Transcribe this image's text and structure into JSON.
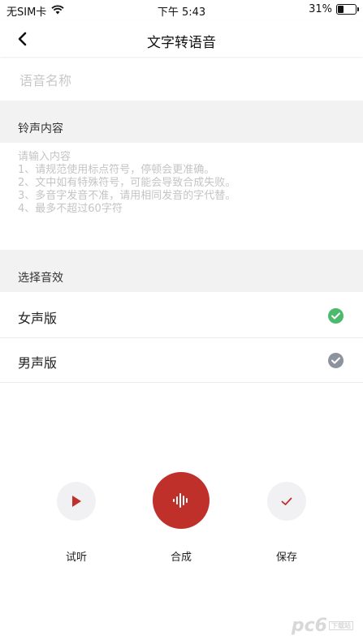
{
  "status_bar": {
    "carrier": "无SIM卡",
    "time": "下午 5:43",
    "battery_percent": "31%",
    "battery_level": 0.31
  },
  "nav": {
    "title": "文字转语音"
  },
  "voice_name": {
    "placeholder": "语音名称",
    "value": ""
  },
  "ringtone_section": {
    "title": "铃声内容",
    "placeholder": "请输入内容\n1、请规范使用标点符号，停顿会更准确。\n2、文中如有特殊符号，可能会导致合成失败。\n3、多音字发音不准，请用相同发音的字代替。\n4、最多不超过60字符",
    "value": ""
  },
  "effect_section": {
    "title": "选择音效",
    "options": [
      {
        "label": "女声版",
        "selected": true
      },
      {
        "label": "男声版",
        "selected": false
      }
    ]
  },
  "actions": {
    "listen_label": "试听",
    "synthesize_label": "合成",
    "save_label": "保存"
  },
  "colors": {
    "primary_red": "#c0302b",
    "check_selected": "#4cba6c",
    "check_unselected": "#8c929e",
    "section_bg": "#f2f2f2",
    "circle_bg": "#f1f1f4"
  },
  "watermark": {
    "text": "pc6",
    "tag": "下载站"
  }
}
